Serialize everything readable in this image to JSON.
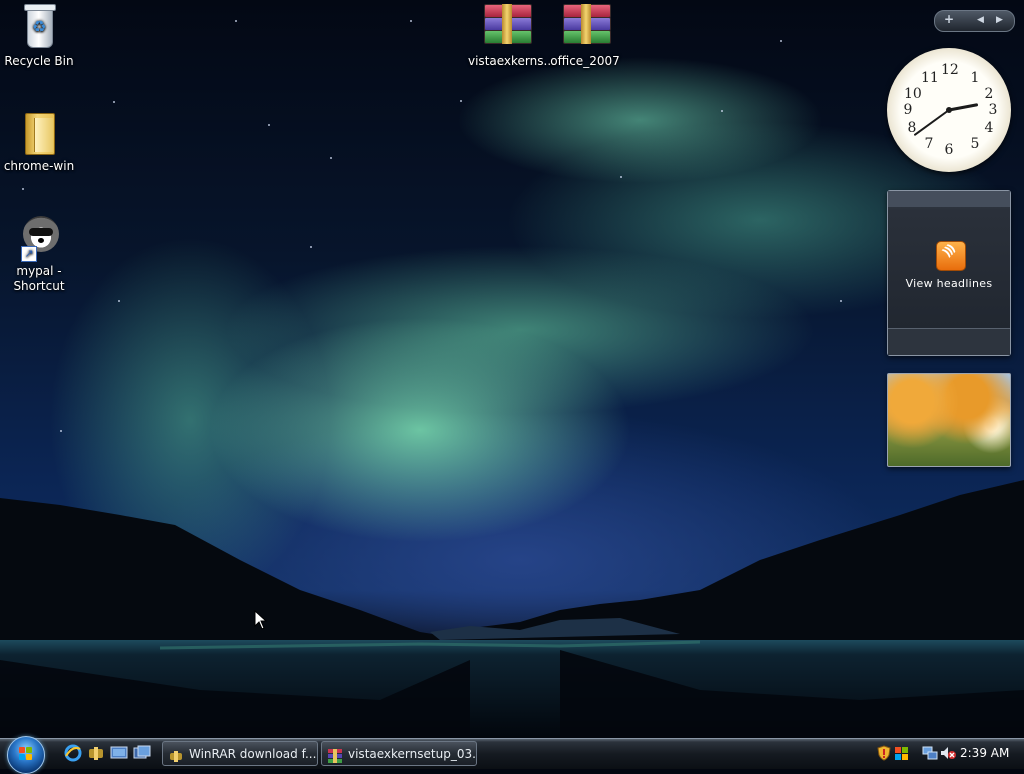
{
  "desktop": {
    "icons": [
      {
        "label": "Recycle Bin",
        "icon": "recycle-bin-icon"
      },
      {
        "label": "chrome-win",
        "icon": "folder-icon"
      },
      {
        "label": "mypal - Shortcut",
        "icon": "raccoon-app-icon"
      },
      {
        "label": "vistaexkerns...",
        "icon": "winrar-archive-icon"
      },
      {
        "label": "office_2007",
        "icon": "winrar-archive-icon"
      }
    ]
  },
  "sidebar": {
    "controls": {
      "add": "+",
      "prev": "◀",
      "next": "▶"
    },
    "clock": {
      "numbers": [
        "12",
        "1",
        "2",
        "3",
        "4",
        "5",
        "6",
        "7",
        "8",
        "9",
        "10",
        "11"
      ],
      "time": "2:39"
    },
    "feed": {
      "label": "View headlines"
    },
    "slideshow": {
      "image": "autumn-tree-landscape"
    }
  },
  "taskbar": {
    "quick_launch": [
      "internet-explorer-icon",
      "winrar-icon",
      "show-desktop-icon",
      "switch-windows-icon"
    ],
    "tasks": [
      {
        "label": "WinRAR download f...",
        "icon": "winrar-icon"
      },
      {
        "label": "vistaexkernsetup_03...",
        "icon": "winrar-archive-icon"
      }
    ],
    "tray": [
      "security-shield-icon",
      "network-status-icon",
      "network-icon",
      "volume-muted-icon"
    ],
    "clock": "2:39 AM"
  },
  "colors": {
    "aurora": "#8cf7be",
    "taskbar": "#151a21",
    "start_orb": "#2a77c9"
  }
}
